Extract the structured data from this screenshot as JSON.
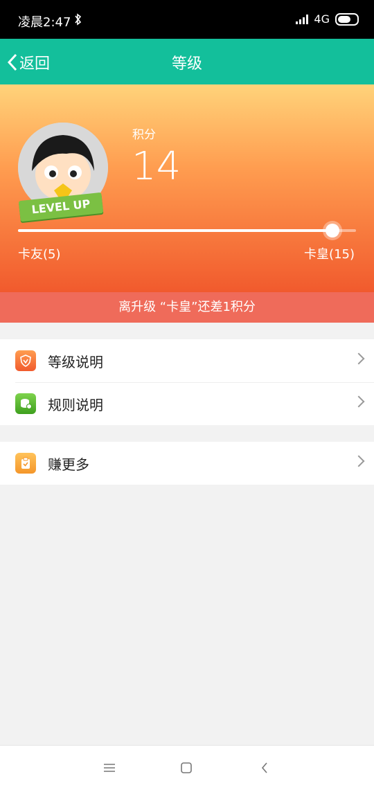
{
  "status_bar": {
    "time": "凌晨2:47",
    "network": "4G"
  },
  "nav": {
    "back_label": "返回",
    "title": "等级"
  },
  "hero": {
    "badge_text": "LEVEL UP",
    "score_label": "积分",
    "score_value": "14",
    "progress_fraction": 0.93,
    "level_current": "卡友(5)",
    "level_next": "卡皇(15)"
  },
  "note": "离升级 “卡皇”还差1积分",
  "menu": [
    {
      "label": "等级说明",
      "icon": "shield-icon",
      "color": "#f15a2d"
    },
    {
      "label": "规则说明",
      "icon": "coins-icon",
      "color": "#5cb531"
    },
    {
      "label": "赚更多",
      "icon": "clipboard-check-icon",
      "color": "#f4a32a"
    }
  ]
}
